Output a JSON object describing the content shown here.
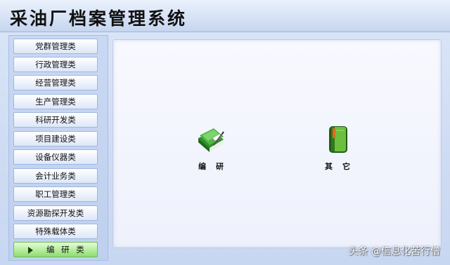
{
  "window": {
    "title": "采油厂档案管理系统"
  },
  "sidebar": {
    "items": [
      {
        "label": "党群管理类"
      },
      {
        "label": "行政管理类"
      },
      {
        "label": "经营管理类"
      },
      {
        "label": "生产管理类"
      },
      {
        "label": "科研开发类"
      },
      {
        "label": "项目建设类"
      },
      {
        "label": "设备仪器类"
      },
      {
        "label": "会计业务类"
      },
      {
        "label": "职工管理类"
      },
      {
        "label": "资源勘探开发类"
      },
      {
        "label": "特殊载体类"
      },
      {
        "label": "编 研 类",
        "selected": true
      }
    ]
  },
  "main": {
    "modules": [
      {
        "label": "编研",
        "icon": "book-pen-icon"
      },
      {
        "label": "其它",
        "icon": "green-book-icon"
      }
    ]
  },
  "watermark": {
    "text": "头条 @信息化苦行僧"
  },
  "colors": {
    "active_nav": "#8edb73",
    "nav_border": "#9fb6df",
    "content_bg": "#f3f5fe",
    "background": "#cfdcf3"
  }
}
